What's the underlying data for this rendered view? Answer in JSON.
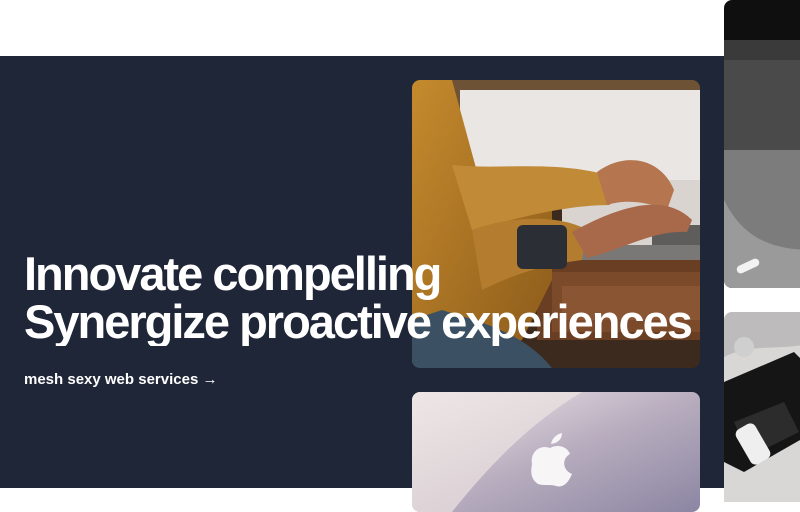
{
  "hero": {
    "headline_line1": "Innovate compelling",
    "headline_line2": "Synergize proactive experiences",
    "cta_label": "mesh sexy web services →"
  },
  "images": [
    {
      "name": "typing-on-laptop-photo"
    },
    {
      "name": "apple-laptop-lid-photo"
    },
    {
      "name": "dark-laptop-photo"
    },
    {
      "name": "desk-items-photo"
    }
  ],
  "colors": {
    "hero_background": "#1f2637",
    "text": "#ffffff",
    "page_background": "#ffffff"
  }
}
